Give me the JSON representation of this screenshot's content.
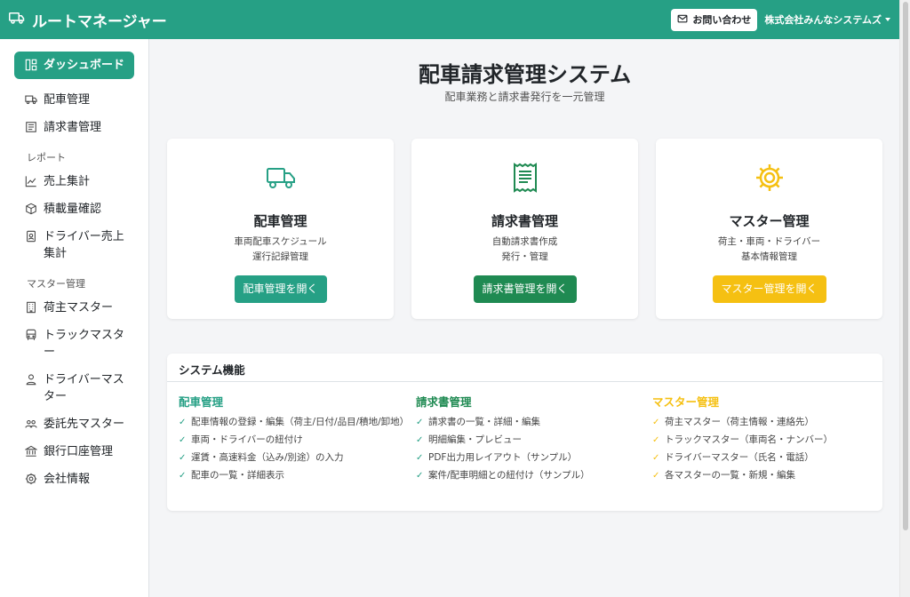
{
  "app": {
    "title": "ルートマネージャー",
    "contact_label": "お問い合わせ",
    "company": "株式会社みんなシステムズ"
  },
  "colors": {
    "primary": "#26a085",
    "dark_green": "#1f8a52",
    "yellow": "#f5c012"
  },
  "sidebar": {
    "dashboard": "ダッシュボード",
    "dispatch": "配車管理",
    "invoice": "請求書管理",
    "report_section": "レポート",
    "sales": "売上集計",
    "load": "積載量確認",
    "driver_sales": "ドライバー売上集計",
    "master_section": "マスター管理",
    "shipper_master": "荷主マスター",
    "truck_master": "トラックマスター",
    "driver_master": "ドライバーマスター",
    "contractor_master": "委託先マスター",
    "bank_account": "銀行口座管理",
    "company_info": "会社情報"
  },
  "main": {
    "title": "配車請求管理システム",
    "subtitle": "配車業務と請求書発行を一元管理",
    "cards": [
      {
        "title": "配車管理",
        "desc1": "車両配車スケジュール",
        "desc2": "運行記録管理",
        "button": "配車管理を開く"
      },
      {
        "title": "請求書管理",
        "desc1": "自動請求書作成",
        "desc2": "発行・管理",
        "button": "請求書管理を開く"
      },
      {
        "title": "マスター管理",
        "desc1": "荷主・車両・ドライバー",
        "desc2": "基本情報管理",
        "button": "マスター管理を開く"
      }
    ],
    "features": {
      "heading": "システム機能",
      "columns": [
        {
          "title": "配車管理",
          "items": [
            "配車情報の登録・編集（荷主/日付/品目/積地/卸地）",
            "車両・ドライバーの紐付け",
            "運賃・高速料金（込み/別途）の入力",
            "配車の一覧・詳細表示"
          ]
        },
        {
          "title": "請求書管理",
          "items": [
            "請求書の一覧・詳細・編集",
            "明細編集・プレビュー",
            "PDF出力用レイアウト（サンプル）",
            "案件/配車明細との紐付け（サンプル）"
          ]
        },
        {
          "title": "マスター管理",
          "items": [
            "荷主マスター（荷主情報・連絡先）",
            "トラックマスター（車両名・ナンバー）",
            "ドライバーマスター（氏名・電話）",
            "各マスターの一覧・新規・編集"
          ]
        }
      ]
    }
  }
}
